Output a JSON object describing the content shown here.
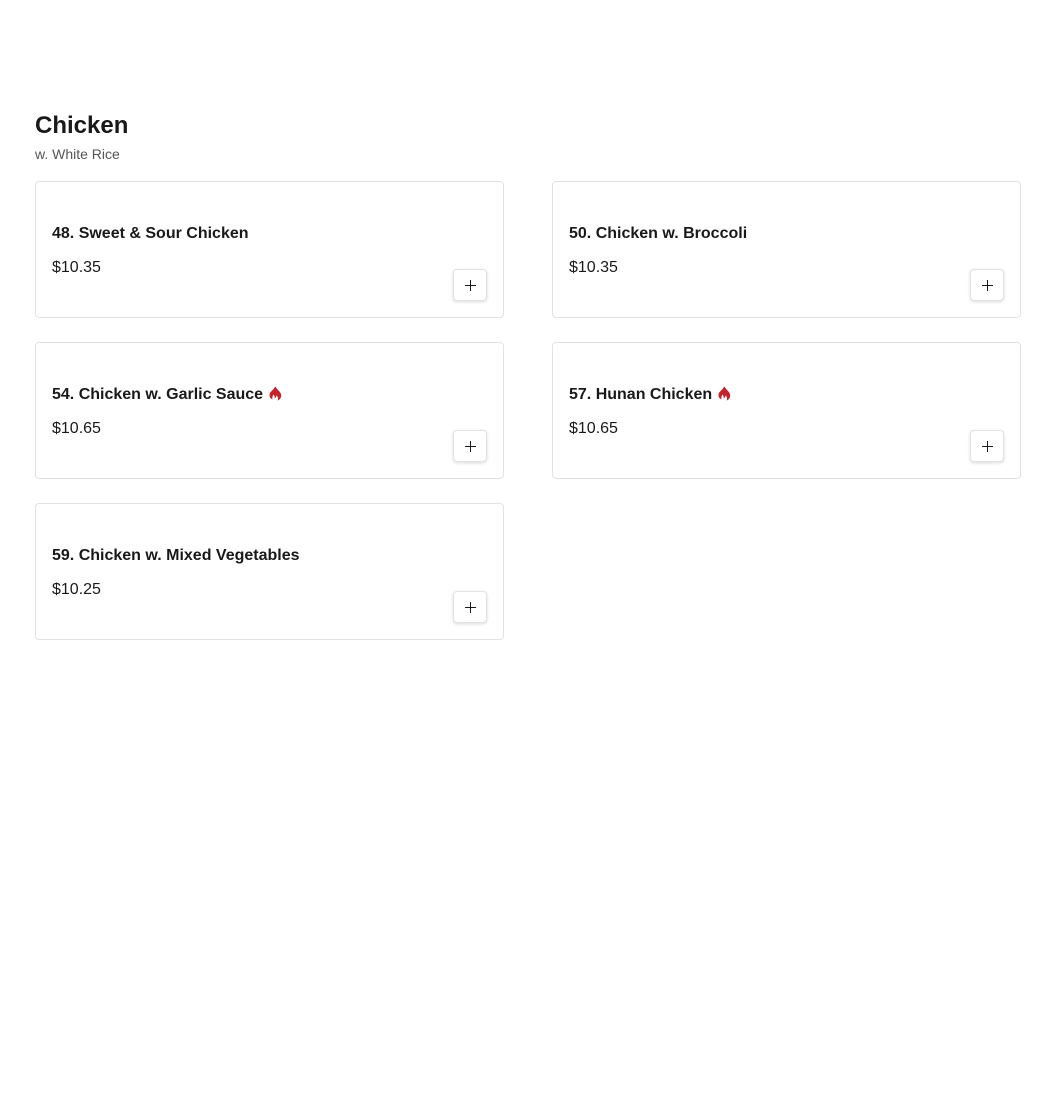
{
  "section": {
    "title": "Chicken",
    "subtitle": "w. White Rice"
  },
  "items": [
    {
      "name": "48. Sweet & Sour Chicken",
      "price": "$10.35",
      "spicy": false,
      "icon": "plus-icon"
    },
    {
      "name": "50. Chicken w. Broccoli",
      "price": "$10.35",
      "spicy": false,
      "icon": "plus-icon"
    },
    {
      "name": "54. Chicken w. Garlic Sauce",
      "price": "$10.65",
      "spicy": true,
      "icon": "plus-icon"
    },
    {
      "name": "57. Hunan Chicken",
      "price": "$10.65",
      "spicy": true,
      "icon": "plus-icon"
    },
    {
      "name": "59. Chicken w. Mixed Vegetables",
      "price": "$10.25",
      "spicy": false,
      "icon": "plus-icon"
    }
  ],
  "colors": {
    "spicy": "#c4232b",
    "text": "#191919",
    "border": "#e2e2e2"
  }
}
